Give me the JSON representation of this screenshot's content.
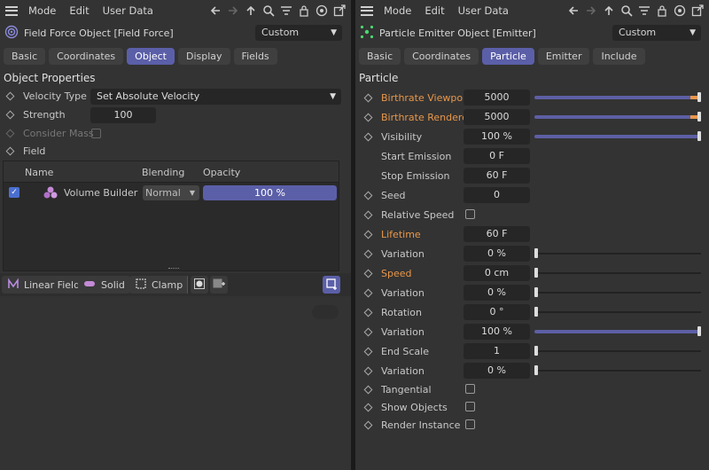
{
  "menu": [
    "Mode",
    "Edit",
    "User Data"
  ],
  "left": {
    "title": "Field Force Object [Field Force]",
    "preset": "Custom",
    "tabs": [
      "Basic",
      "Coordinates",
      "Object",
      "Display",
      "Fields"
    ],
    "active_tab": "Object",
    "section": "Object Properties",
    "velocity_type_label": "Velocity Type",
    "velocity_type_value": "Set Absolute Velocity",
    "strength_label": "Strength",
    "strength_value": "100",
    "consider_mass_label": "Consider Mass",
    "field_label": "Field",
    "table": {
      "headers": [
        "Name",
        "Blending",
        "Opacity"
      ],
      "row": {
        "name": "Volume Builder",
        "blending": "Normal",
        "opacity": "100 %",
        "opacity_fraction": 1.0
      }
    },
    "bottom": {
      "linear_field": "Linear Field",
      "solid": "Solid",
      "clamp": "Clamp"
    }
  },
  "right": {
    "title": "Particle Emitter Object [Emitter]",
    "preset": "Custom",
    "tabs": [
      "Basic",
      "Coordinates",
      "Particle",
      "Emitter",
      "Include"
    ],
    "active_tab": "Particle",
    "section": "Particle",
    "params": [
      {
        "label": "Birthrate Viewport",
        "value": "5000",
        "orange": true,
        "slider": 1.0,
        "orange_end": true
      },
      {
        "label": "Birthrate Renderer",
        "value": "5000",
        "orange": true,
        "slider": 1.0,
        "orange_end": true
      },
      {
        "label": "Visibility",
        "value": "100 %",
        "orange": false,
        "slider": 1.0
      },
      {
        "label": "Start Emission",
        "value": "0 F",
        "nodiamond": true
      },
      {
        "label": "Stop Emission",
        "value": "60 F",
        "nodiamond": true
      },
      {
        "label": "Seed",
        "value": "0"
      },
      {
        "label": "Relative Speed",
        "checkbox": true
      },
      {
        "label": "Lifetime",
        "value": "60 F",
        "orange": true
      },
      {
        "label": "Variation",
        "value": "0 %",
        "slider": 0.0
      },
      {
        "label": "Speed",
        "value": "0 cm",
        "orange": true,
        "slider": 0.0
      },
      {
        "label": "Variation",
        "value": "0 %",
        "slider": 0.0
      },
      {
        "label": "Rotation",
        "value": "0 °",
        "slider": 0.0
      },
      {
        "label": "Variation",
        "value": "100 %",
        "slider": 1.0
      },
      {
        "label": "End Scale",
        "value": "1",
        "slider": 0.0
      },
      {
        "label": "Variation",
        "value": "0 %",
        "slider": 0.0
      },
      {
        "label": "Tangential",
        "checkbox": true,
        "short": true
      },
      {
        "label": "Show Objects",
        "checkbox": true,
        "short": true
      },
      {
        "label": "Render Instance",
        "checkbox": true,
        "short": true
      }
    ]
  },
  "colors": {
    "accent": "#5b5fa8",
    "orange": "#e8974a"
  }
}
